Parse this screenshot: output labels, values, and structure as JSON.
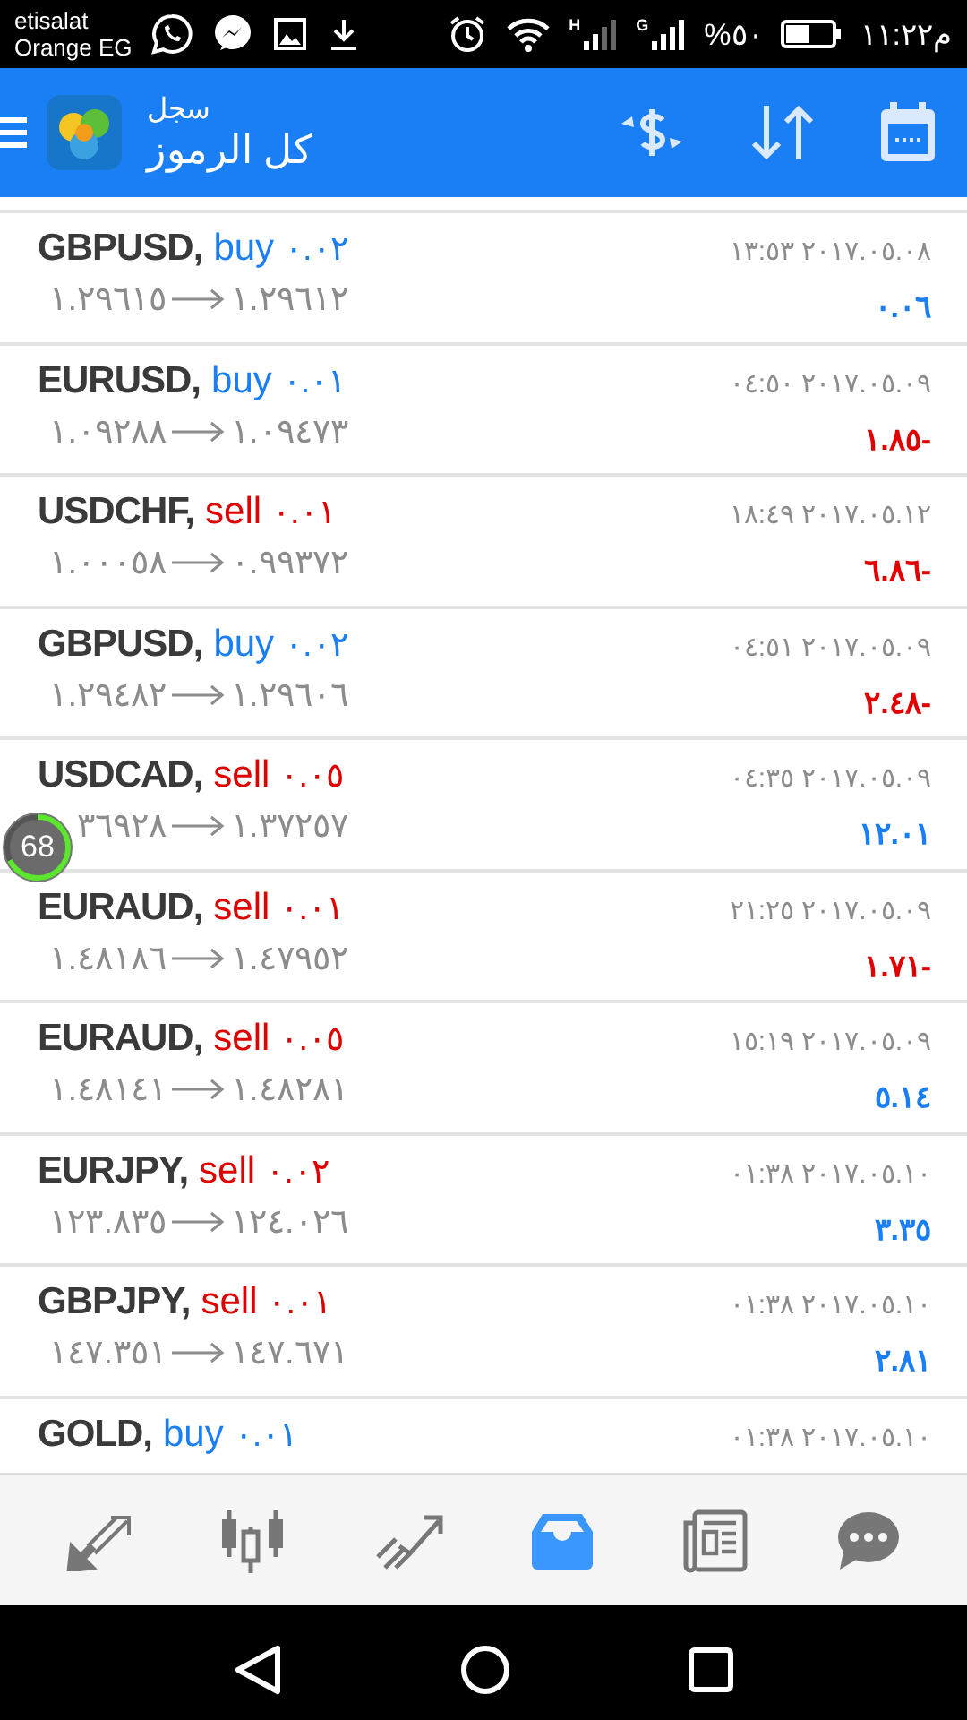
{
  "status_bar": {
    "carrier_lines": [
      "etisalat",
      "Orange EG"
    ],
    "network_label_left": "H",
    "network_label_right": "G",
    "battery": "%٥٠",
    "time": "١١:٢٢م"
  },
  "header": {
    "subtitle": "سجل",
    "title": "كل الرموز"
  },
  "trades": [
    {
      "symbol": "GBPUSD,",
      "kind": "buy",
      "side": "buy",
      "volume": "٠.٠٢",
      "open_price": "١.٢٩٦١٥",
      "close_price": "١.٢٩٦١٢",
      "time": "١٣:٥٣ ٢٠١٧.٠٥.٠٨",
      "profit": "٠.٠٦",
      "loss": false
    },
    {
      "symbol": "EURUSD,",
      "kind": "buy",
      "side": "buy",
      "volume": "٠.٠١",
      "open_price": "١.٠٩٢٨٨",
      "close_price": "١.٠٩٤٧٣",
      "time": "٠٤:٥٠ ٢٠١٧.٠٥.٠٩",
      "profit": "١.٨٥-",
      "loss": true
    },
    {
      "symbol": "USDCHF,",
      "kind": "sell",
      "side": "sell",
      "volume": "٠.٠١",
      "open_price": "١.٠٠٠٥٨",
      "close_price": "٠.٩٩٣٧٢",
      "time": "١٨:٤٩ ٢٠١٧.٠٥.١٢",
      "profit": "٦.٨٦-",
      "loss": true
    },
    {
      "symbol": "GBPUSD,",
      "kind": "buy",
      "side": "buy",
      "volume": "٠.٠٢",
      "open_price": "١.٢٩٤٨٢",
      "close_price": "١.٢٩٦٠٦",
      "time": "٠٤:٥١ ٢٠١٧.٠٥.٠٩",
      "profit": "٢.٤٨-",
      "loss": true
    },
    {
      "symbol": "USDCAD,",
      "kind": "sell",
      "side": "sell",
      "volume": "٠.٠٥",
      "open_price": "٣٦٩٢٨",
      "close_price": "١.٣٧٢٥٧",
      "time": "٠٤:٣٥ ٢٠١٧.٠٥.٠٩",
      "profit": "١٢.٠١",
      "loss": false
    },
    {
      "symbol": "EURAUD,",
      "kind": "sell",
      "side": "sell",
      "volume": "٠.٠١",
      "open_price": "١.٤٨١٨٦",
      "close_price": "١.٤٧٩٥٢",
      "time": "٢١:٢٥ ٢٠١٧.٠٥.٠٩",
      "profit": "١.٧١-",
      "loss": true
    },
    {
      "symbol": "EURAUD,",
      "kind": "sell",
      "side": "sell",
      "volume": "٠.٠٥",
      "open_price": "١.٤٨١٤١",
      "close_price": "١.٤٨٢٨١",
      "time": "١٥:١٩ ٢٠١٧.٠٥.٠٩",
      "profit": "٥.١٤",
      "loss": false
    },
    {
      "symbol": "EURJPY,",
      "kind": "sell",
      "side": "sell",
      "volume": "٠.٠٢",
      "open_price": "١٢٣.٨٣٥",
      "close_price": "١٢٤.٠٢٦",
      "time": "٠١:٣٨ ٢٠١٧.٠٥.١٠",
      "profit": "٣.٣٥",
      "loss": false
    },
    {
      "symbol": "GBPJPY,",
      "kind": "sell",
      "side": "sell",
      "volume": "٠.٠١",
      "open_price": "١٤٧.٣٥١",
      "close_price": "١٤٧.٦٧١",
      "time": "٠١:٣٨ ٢٠١٧.٠٥.١٠",
      "profit": "٢.٨١",
      "loss": false
    },
    {
      "symbol": "GOLD,",
      "kind": "buy",
      "side": "buy",
      "volume": "٠.٠١",
      "time": "٠١:٣٨ ٢٠١٧.٠٥.١٠"
    }
  ],
  "overlay_badge": {
    "text": "68",
    "level": 0.68
  },
  "bottom_nav": [
    {
      "selected": false
    },
    {
      "selected": false
    },
    {
      "selected": false
    },
    {
      "selected": true
    },
    {
      "selected": false
    },
    {
      "selected": false
    }
  ]
}
